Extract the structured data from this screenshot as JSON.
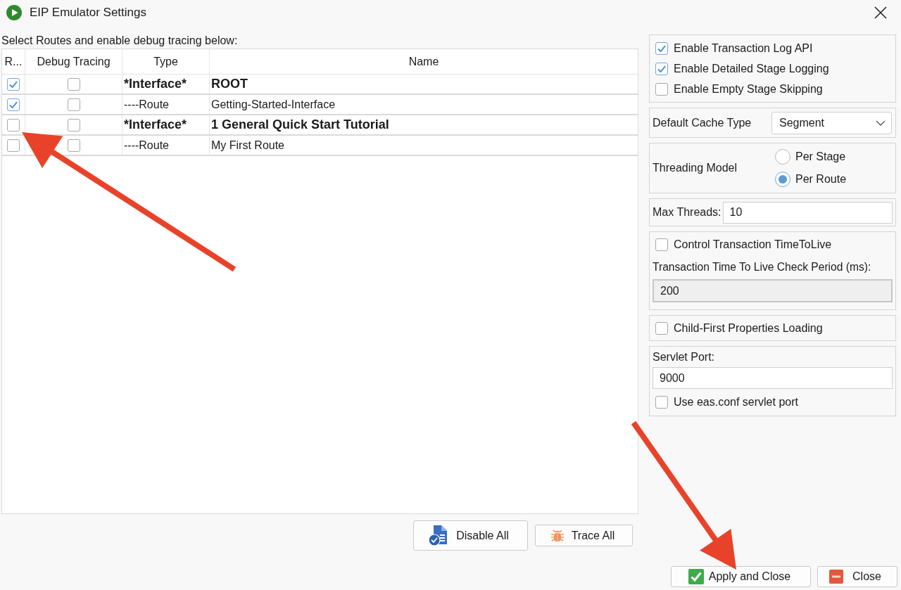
{
  "window": {
    "title": "EIP Emulator Settings"
  },
  "instructions": "Select Routes and enable debug tracing below:",
  "routes_table": {
    "columns": [
      "R...",
      "Debug Tracing",
      "Type",
      "Name"
    ],
    "rows": [
      {
        "kind": "interface",
        "enabled": true,
        "debug_tracing": false,
        "type": "*Interface*",
        "name": "ROOT"
      },
      {
        "kind": "route",
        "enabled": true,
        "debug_tracing": false,
        "type": "----Route",
        "name": "Getting-Started-Interface"
      },
      {
        "kind": "interface",
        "enabled": false,
        "debug_tracing": false,
        "type": "*Interface*",
        "name": "1 General Quick Start Tutorial"
      },
      {
        "kind": "route",
        "enabled": false,
        "debug_tracing": false,
        "type": "----Route",
        "name": "My First Route"
      }
    ]
  },
  "table_buttons": [
    {
      "kind": "disable",
      "label": "Disable All"
    },
    {
      "kind": "trace",
      "label": "Trace All"
    }
  ],
  "settings": {
    "logging_options": [
      {
        "label": "Enable Transaction Log API",
        "checked": true
      },
      {
        "label": "Enable Detailed Stage Logging",
        "checked": true
      },
      {
        "label": "Enable Empty Stage Skipping",
        "checked": false
      }
    ],
    "cache_type": {
      "label": "Default Cache Type",
      "value": "Segment"
    },
    "threading_model": {
      "label": "Threading Model",
      "options": [
        {
          "label": "Per Stage",
          "selected": false
        },
        {
          "label": "Per Route",
          "selected": true
        }
      ]
    },
    "max_threads": {
      "label": "Max Threads:",
      "value": "10"
    },
    "time_to_live": {
      "control": {
        "label": "Control Transaction TimeToLive",
        "checked": false
      },
      "period_label": "Transaction Time To Live Check Period (ms):",
      "period_value": "200",
      "period_disabled": true
    },
    "child_first_loading": {
      "label": "Child-First Properties Loading",
      "checked": false
    },
    "servlet_port": {
      "label": "Servlet Port:",
      "value": "9000",
      "use_conf_port": {
        "label": "Use eas.conf servlet port",
        "checked": false
      }
    }
  },
  "dialog_buttons": [
    {
      "kind": "apply",
      "label": "Apply and Close"
    },
    {
      "kind": "close",
      "label": "Close"
    }
  ],
  "annotations": [
    {
      "kind": "arrow"
    },
    {
      "kind": "arrow"
    }
  ]
}
